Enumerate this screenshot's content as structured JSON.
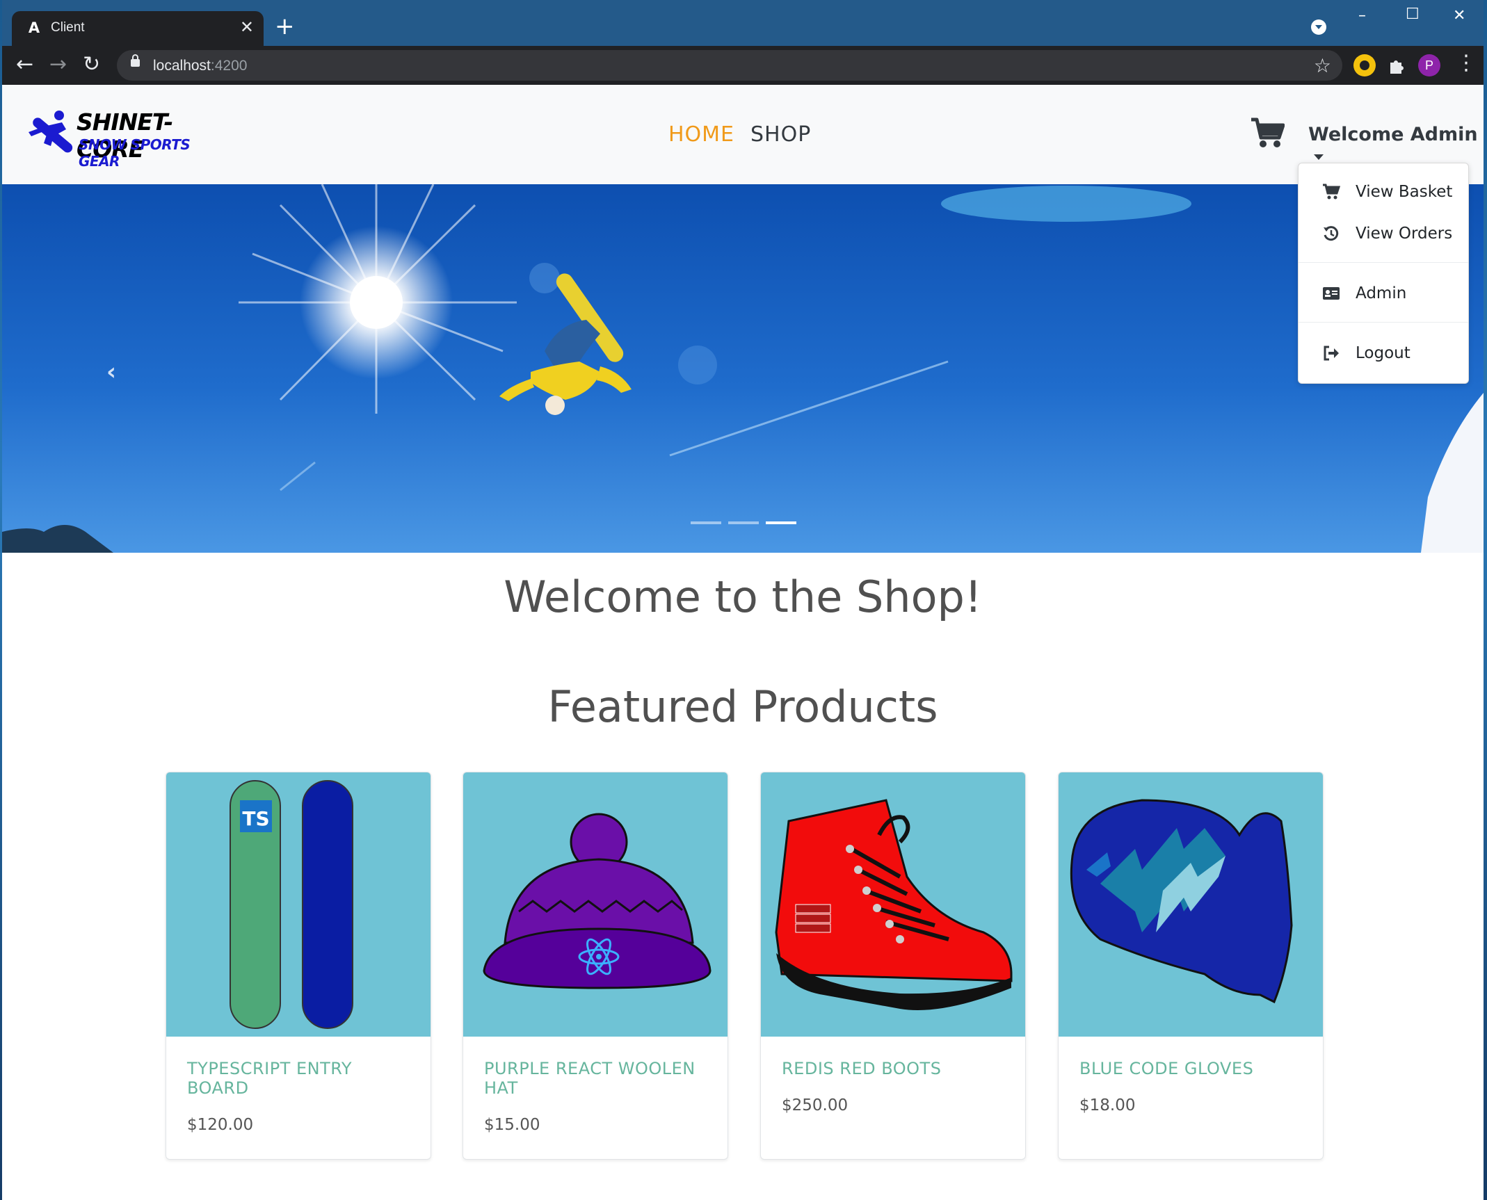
{
  "browser": {
    "tab_title": "Client",
    "tab_favicon_letter": "A",
    "new_tab_label": "+",
    "url_host": "localhost",
    "url_port": ":4200",
    "profile_letter": "P"
  },
  "navbar": {
    "logo_line1": "SHINET-CORE",
    "logo_line2": "SNOW SPORTS GEAR",
    "links": [
      {
        "label": "HOME",
        "active": true,
        "color": "#f09a1a"
      },
      {
        "label": "SHOP",
        "active": false,
        "color": "#343a40"
      }
    ],
    "welcome": "Welcome Admin"
  },
  "user_menu": {
    "items": [
      {
        "label": "View Basket",
        "icon": "shopping-cart-icon"
      },
      {
        "label": "View Orders",
        "icon": "history-icon"
      },
      {
        "label": "Admin",
        "icon": "id-card-icon"
      },
      {
        "label": "Logout",
        "icon": "sign-out-icon"
      }
    ]
  },
  "carousel": {
    "slide_count": 3,
    "active_index": 2,
    "prev_icon": "chevron-left-icon"
  },
  "headings": {
    "welcome": "Welcome to the Shop!",
    "featured": "Featured Products"
  },
  "products": [
    {
      "name": "TYPESCRIPT ENTRY BOARD",
      "price": "$120.00",
      "image": "snowboards"
    },
    {
      "name": "PURPLE REACT WOOLEN HAT",
      "price": "$15.00",
      "image": "woolen-hat"
    },
    {
      "name": "REDIS RED BOOTS",
      "price": "$250.00",
      "image": "red-boot"
    },
    {
      "name": "BLUE CODE GLOVES",
      "price": "$18.00",
      "image": "mitten"
    }
  ],
  "colors": {
    "accent_active": "#f09a1a",
    "product_name": "#66b59d",
    "card_image_bg": "#6fc3d5"
  }
}
